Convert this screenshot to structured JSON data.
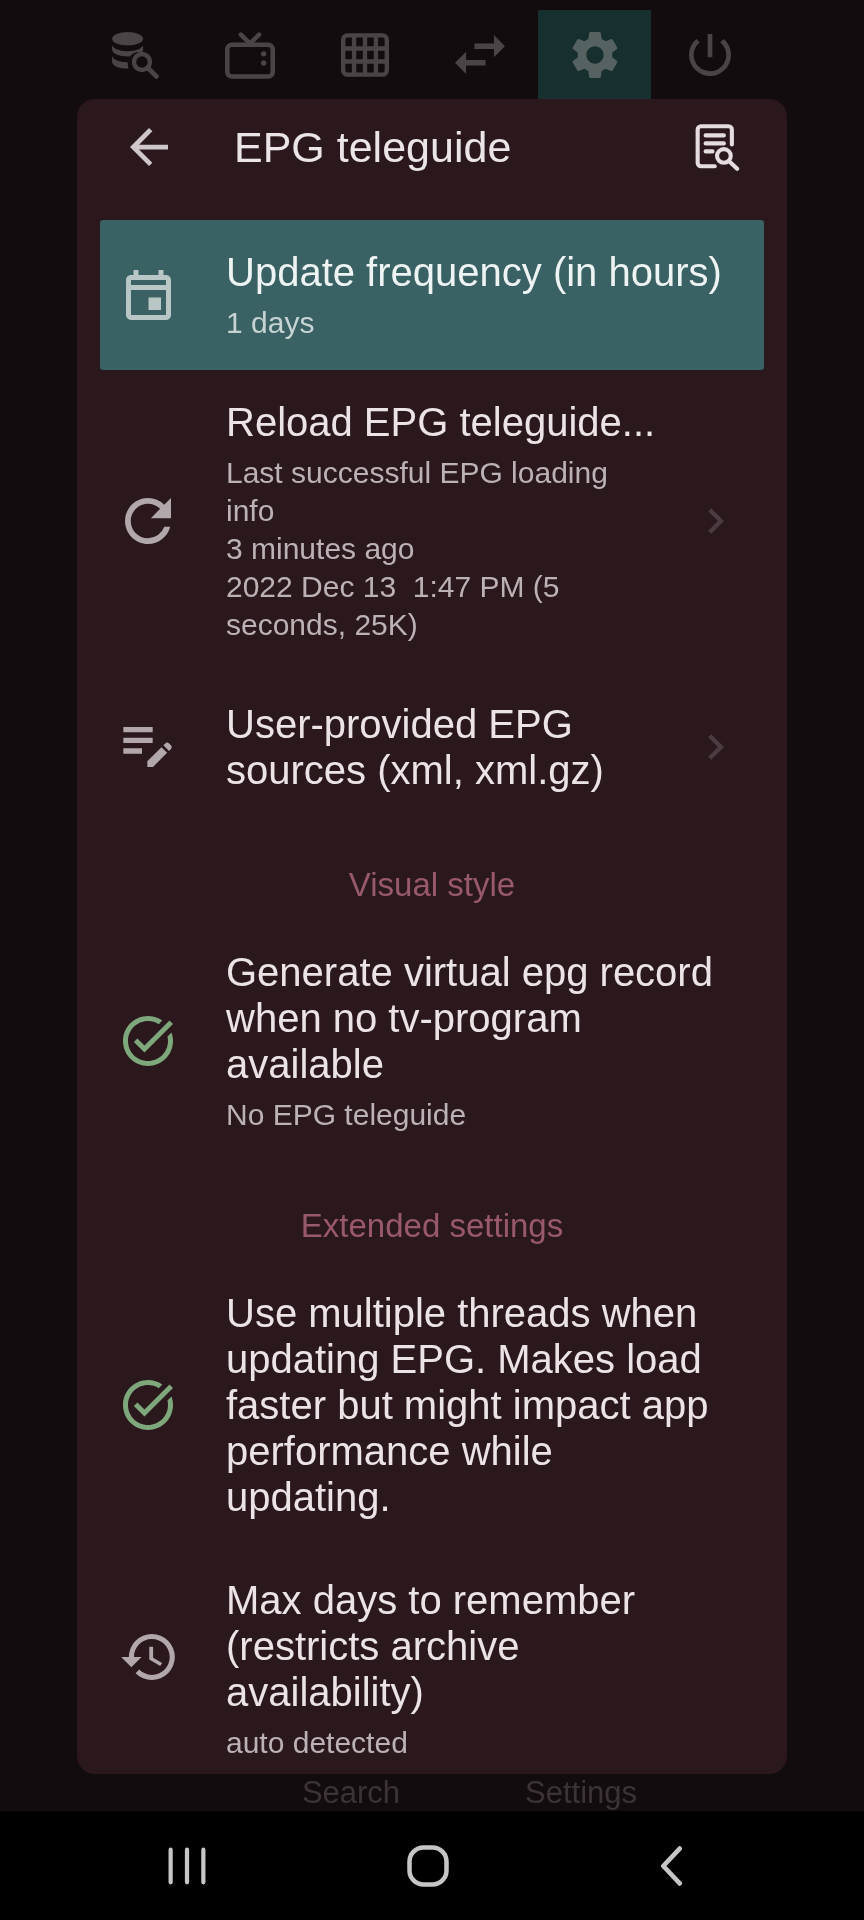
{
  "toolbar": [
    {
      "selected": false
    },
    {
      "selected": false
    },
    {
      "selected": false
    },
    {
      "selected": false
    },
    {
      "selected": true
    },
    {
      "selected": false
    }
  ],
  "dialog": {
    "title": "EPG teleguide",
    "rows": [
      {
        "kind": "setting",
        "title": "Update frequency (in hours)",
        "subtitle": [
          "1 days"
        ],
        "selected": true,
        "chevron": false
      },
      {
        "kind": "setting",
        "title": "Reload EPG teleguide...",
        "subtitle": [
          "Last successful EPG loading info",
          "3 minutes ago",
          "2022 Dec 13  1:47 PM (5 seconds, 25K)"
        ],
        "selected": false,
        "chevron": true
      },
      {
        "kind": "setting",
        "title": "User-provided EPG sources (xml, xml.gz)",
        "selected": false,
        "chevron": true
      },
      {
        "kind": "section",
        "title": "Visual style"
      },
      {
        "kind": "toggle",
        "title": "Generate virtual epg record when no tv-program available",
        "subtitle": [
          "No EPG teleguide"
        ],
        "checked": true
      },
      {
        "kind": "section",
        "title": "Extended settings"
      },
      {
        "kind": "toggle",
        "title": "Use multiple threads when updating EPG. Makes load faster but might impact app performance while updating.",
        "checked": true
      },
      {
        "kind": "setting",
        "title": "Max days to remember (restricts archive availability)",
        "subtitle": [
          "auto detected"
        ],
        "selected": false,
        "chevron": false
      }
    ]
  },
  "bottom_tabs": [
    "Search",
    "Settings"
  ]
}
